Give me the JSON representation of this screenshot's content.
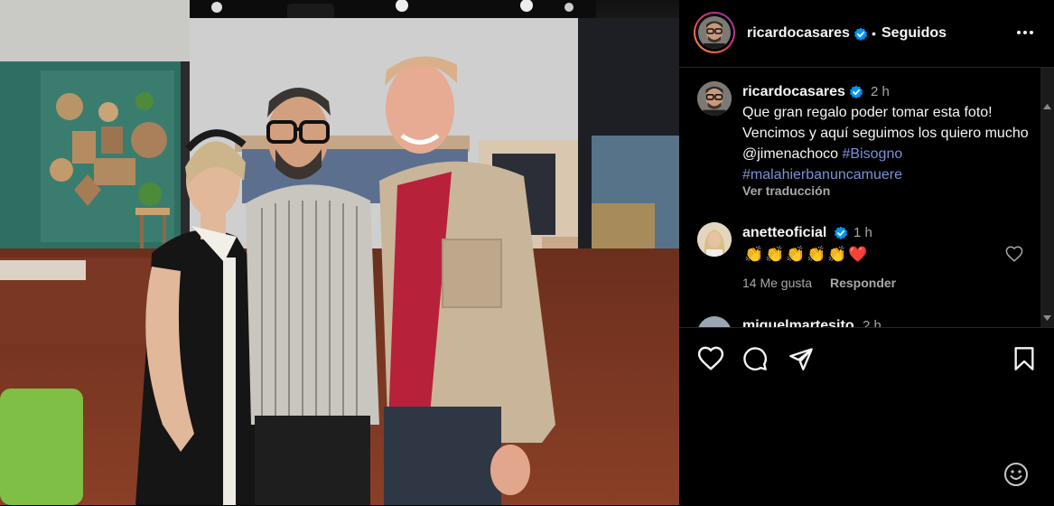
{
  "post": {
    "username": "ricardocasares",
    "following_label": "Seguidos",
    "separator": "•",
    "more_icon": "more-horizontal-icon"
  },
  "caption": {
    "username": "ricardocasares",
    "time": "2 h",
    "text_main": "Que gran regalo poder tomar esta foto! Vencimos y aquí seguimos los quiero mucho ",
    "mention": "@jimenachoco",
    "hashtag1": "#Bisogno",
    "hashtag2": "#malahierbanuncamuere",
    "translate_label": "Ver traducción"
  },
  "comments": [
    {
      "username": "anetteoficial",
      "time": "1 h",
      "emojis": [
        "👏",
        "👏",
        "👏",
        "👏",
        "👏",
        "❤️"
      ],
      "likes_label": "14 Me gusta",
      "reply_label": "Responder"
    },
    {
      "username": "miguelmartesito",
      "time": "2 h"
    }
  ],
  "actions": {
    "like_icon": "heart-icon",
    "comment_icon": "comment-icon",
    "share_icon": "share-icon",
    "save_icon": "bookmark-icon",
    "emoji_icon": "emoji-icon"
  },
  "colors": {
    "background": "#000000",
    "link": "#7b91d6",
    "verified": "#0095f6",
    "secondary_text": "#a8a8a8"
  }
}
